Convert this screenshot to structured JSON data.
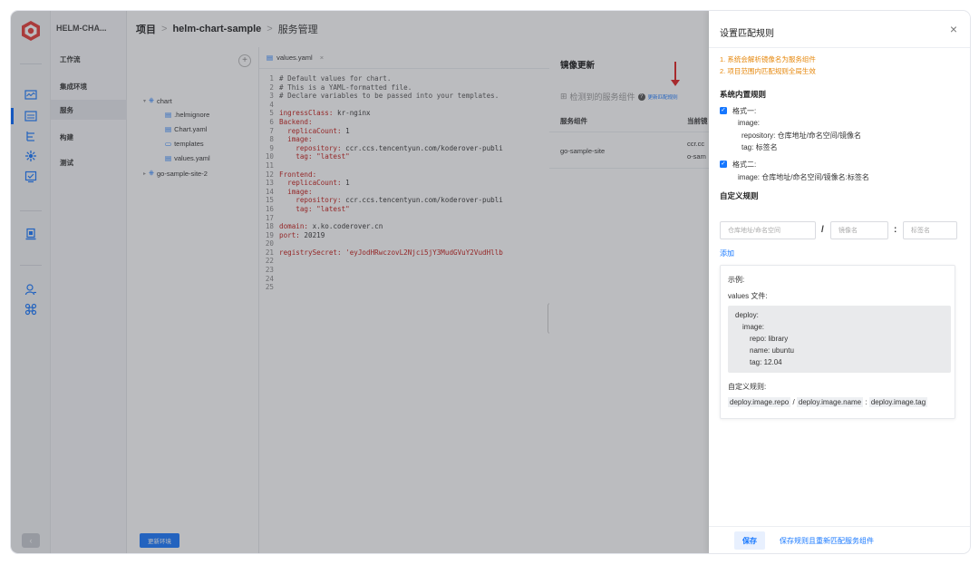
{
  "rail": {
    "icons": [
      "logo-icon",
      "monitor-icon",
      "service-icon",
      "tree-icon",
      "build-icon",
      "test-icon",
      "deploy-icon",
      "user-icon",
      "plugin-icon"
    ],
    "collapse_label": "‹"
  },
  "subnav": {
    "project": "HELM-CHA...",
    "items": [
      "工作流",
      "集成环境",
      "服务",
      "构建",
      "测试"
    ],
    "update_env": "更新环境"
  },
  "header": {
    "crumb1": "项目",
    "crumb2": "helm-chart-sample",
    "crumb3": "服务管理",
    "sep": ">"
  },
  "tree": {
    "add": "+",
    "nodes": [
      "chart",
      ".helmignore",
      "Chart.yaml",
      "templates",
      "values.yaml",
      "go-sample-site-2"
    ]
  },
  "editor": {
    "tab": "values.yaml",
    "tab_close": "×",
    "lines": [
      "# Default values for chart.",
      "# This is a YAML-formatted file.",
      "# Declare variables to be passed into your templates.",
      "",
      "ingressClass: kr-nginx",
      "Backend:",
      "  replicaCount: 1",
      "  image:",
      "    repository: ccr.ccs.tencentyun.com/koderover-publi",
      "    tag: \"latest\"",
      "",
      "Frontend:",
      "  replicaCount: 1",
      "  image:",
      "    repository: ccr.ccs.tencentyun.com/koderover-publi",
      "    tag: \"latest\"",
      "",
      "domain: x.ko.coderover.cn",
      "port: 20219",
      "",
      "registrySecret: 'eyJodHRwczovL2Njci5jY3MudGVuY2VudHllb",
      "",
      "",
      "",
      ""
    ]
  },
  "image_panel": {
    "title": "镜像更新",
    "detected": "检测到的服务组件",
    "detected_link": "更新匹配规则",
    "col_component": "服务组件",
    "col_current": "当前镜",
    "row_name": "go-sample-site",
    "row_image_l1": "ccr.cc",
    "row_image_l2": "o-sam"
  },
  "drawer": {
    "title": "设置匹配规则",
    "close": "×",
    "tip1": "1. 系统会解析镜像名为服务组件",
    "tip2": "2. 项目范围内匹配规则全局生效",
    "builtin_title": "系统内置规则",
    "fmt1_label": "格式一:",
    "fmt1_l1": "image:",
    "fmt1_l2": "repository: 仓库地址/命名空间/镜像名",
    "fmt1_l3": "tag: 标签名",
    "fmt2_label": "格式二:",
    "fmt2_l1": "image: 仓库地址/命名空间/镜像名:标签名",
    "custom_title": "自定义规则",
    "ph_repo": "仓库地址/命名空间",
    "ph_name": "镜像名",
    "ph_tag": "标签名",
    "slash": "/",
    "colon": ":",
    "add": "添加",
    "example_title": "示例:",
    "values_file": "values 文件:",
    "ex_l1": "deploy:",
    "ex_l2": "image:",
    "ex_l3": "repo: library",
    "ex_l4": "name: ubuntu",
    "ex_l5": "tag: 12.04",
    "custom_rule_label": "自定义规则:",
    "rule_repo": "deploy.image.repo",
    "rule_slash": " / ",
    "rule_name": "deploy.image.name",
    "rule_colon": " : ",
    "rule_tag": "deploy.image.tag",
    "save": "保存",
    "save_rematch": "保存规则且重新匹配服务组件",
    "check": "✓"
  },
  "colors": {
    "accent": "#1677ff",
    "warning": "#e6870b",
    "arrow": "#e02020"
  }
}
